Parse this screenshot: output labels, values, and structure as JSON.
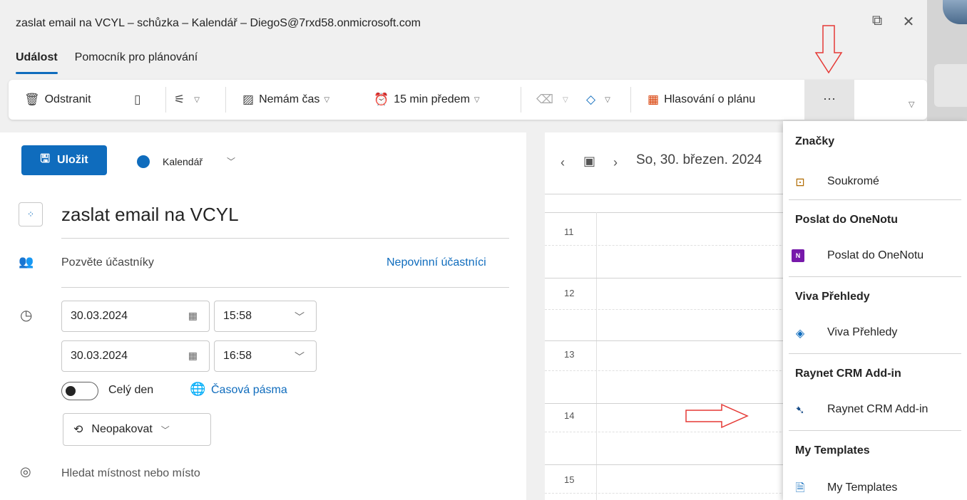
{
  "window": {
    "title": "zaslat email na VCYL – schůzka – Kalendář – DiegoS@7rxd58.onmicrosoft.com"
  },
  "tabs": [
    {
      "label": "Událost",
      "active": true
    },
    {
      "label": "Pomocník pro plánování",
      "active": false
    }
  ],
  "toolbar": {
    "delete_label": "Odstranit",
    "busy_label": "Nemám čas",
    "reminder_label": "15 min předem",
    "poll_label": "Hlasování o plánu",
    "more_label": "···"
  },
  "form": {
    "save_label": "Uložit",
    "calendar_label": "Kalendář",
    "calendar_color": "#0f6cbd",
    "subject": "zaslat email na VCYL",
    "invite_placeholder": "Pozvěte účastníky",
    "optional_link": "Nepovinní účastníci",
    "start_date": "30.03.2024",
    "start_time": "15:58",
    "end_date": "30.03.2024",
    "end_time": "16:58",
    "allday_label": "Celý den",
    "timezone_link": "Časová pásma",
    "repeat_label": "Neopakovat",
    "location_placeholder": "Hledat místnost nebo místo"
  },
  "calendar": {
    "date_heading": "So, 30. březen. 2024",
    "hours": [
      "11",
      "12",
      "13",
      "14",
      "15"
    ]
  },
  "menu": {
    "sections": [
      {
        "header": "Značky",
        "item": "Soukromé",
        "icon": "lock-open-icon"
      },
      {
        "header": "Poslat do OneNotu",
        "item": "Poslat do OneNotu",
        "icon": "onenote-icon"
      },
      {
        "header": "Viva Přehledy",
        "item": "Viva Přehledy",
        "icon": "viva-insights-icon"
      },
      {
        "header": "Raynet CRM Add-in",
        "item": "Raynet CRM Add-in",
        "icon": "raynet-bird-icon"
      },
      {
        "header": "My Templates",
        "item": "My Templates",
        "icon": "templates-icon"
      }
    ]
  },
  "colors": {
    "accent": "#0f6cbd",
    "annotation_arrow": "#e53935"
  }
}
